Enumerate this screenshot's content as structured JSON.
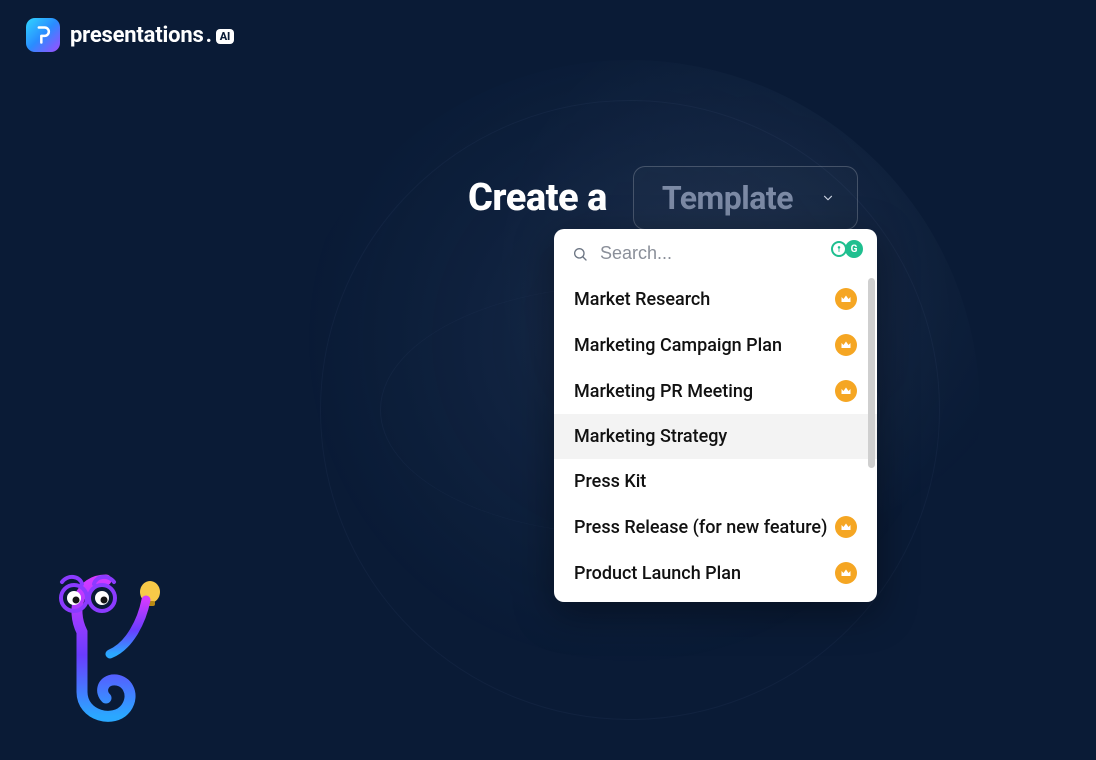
{
  "brand": {
    "name": "presentations",
    "suffix_dot": ".",
    "ai_badge": "AI"
  },
  "headline": {
    "prefix": "Create a",
    "dropdown_label": "Template"
  },
  "search": {
    "placeholder": "Search..."
  },
  "grammarly_badges": {
    "left": "",
    "right": "G"
  },
  "templates": [
    {
      "label": "Market Research",
      "premium": true,
      "hover": false
    },
    {
      "label": "Marketing Campaign Plan",
      "premium": true,
      "hover": false
    },
    {
      "label": "Marketing PR Meeting",
      "premium": true,
      "hover": false
    },
    {
      "label": "Marketing Strategy",
      "premium": false,
      "hover": true
    },
    {
      "label": "Press Kit",
      "premium": false,
      "hover": false
    },
    {
      "label": "Press Release (for new feature)",
      "premium": true,
      "hover": false
    },
    {
      "label": "Product Launch Plan",
      "premium": true,
      "hover": false
    }
  ]
}
